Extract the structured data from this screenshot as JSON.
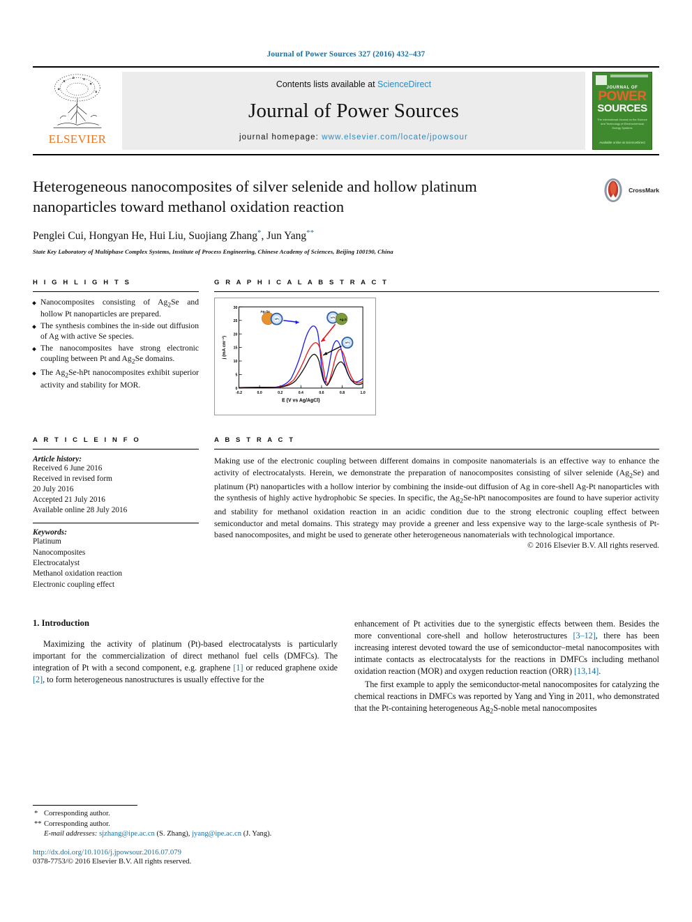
{
  "running_head": "Journal of Power Sources 327 (2016) 432–437",
  "masthead": {
    "contents_prefix": "Contents lists available at ",
    "sciencedirect": "ScienceDirect",
    "journal_name": "Journal of Power Sources",
    "homepage_prefix": "journal homepage: ",
    "homepage_url": "www.elsevier.com/locate/jpowsour",
    "publisher_wordmark": "ELSEVIER",
    "cover": {
      "line_journal_of": "JOURNAL OF",
      "line_power": "POWER",
      "line_sources": "SOURCES",
      "subtitle": "The International Journal on the Science and Technology of Electrochemical Energy Systems",
      "footer": "Available online at\nScienceDirect"
    },
    "accent_blue": "#2b8bc4",
    "elsevier_orange": "#e87722",
    "cover_green": "#3f8a2e"
  },
  "article": {
    "title": "Heterogeneous nanocomposites of silver selenide and hollow platinum nanoparticles toward methanol oxidation reaction",
    "authors_plain": "Penglei Cui, Hongyan He, Hui Liu, Suojiang Zhang",
    "author_last": "Jun Yang",
    "affiliation": "State Key Laboratory of Multiphase Complex Systems, Institute of Process Engineering, Chinese Academy of Sciences, Beijing 100190, China",
    "crossmark_label": "CrossMark"
  },
  "highlights": {
    "heading": "H I G H L I G H T S",
    "items": [
      "Nanocomposites consisting of Ag2Se and hollow Pt nanoparticles are prepared.",
      "The synthesis combines the in-side out diffusion of Ag with active Se species.",
      "The nanocomposites have strong electronic coupling between Pt and Ag2Se domains.",
      "The Ag2Se-hPt nanocomposites exhibit superior activity and stability for MOR."
    ]
  },
  "graphical_abstract": {
    "heading": "G R A P H I C A L   A B S T R A C T"
  },
  "chart_data": {
    "type": "line",
    "title": "",
    "xlabel": "E (V vs Ag/AgCl)",
    "ylabel": "j (mA cm-2)",
    "xlim": [
      -0.2,
      1.0
    ],
    "ylim": [
      0,
      30
    ],
    "xticks": [
      "-0.2",
      "0.0",
      "0.2",
      "0.4",
      "0.6",
      "0.8",
      "1.0"
    ],
    "yticks": [
      "0",
      "5",
      "10",
      "15",
      "20",
      "25",
      "30"
    ],
    "grid": false,
    "legend_position": "inset-annotations",
    "annotations": [
      {
        "label": "Ag2Se-hPt",
        "color": "#2222dd"
      },
      {
        "label": "hPt-Ag2S",
        "color": "#dd2222"
      },
      {
        "label": "hPt",
        "color": "#111111"
      }
    ],
    "series": [
      {
        "name": "Ag2Se-hPt",
        "color": "#1a1aee",
        "forward_peak": {
          "x": 0.53,
          "y": 22.0
        },
        "reverse_peak": {
          "x": 0.66,
          "y": 17.0
        },
        "onset_x": 0.18
      },
      {
        "name": "hPt-Ag2S",
        "color": "#ee1111",
        "forward_peak": {
          "x": 0.57,
          "y": 14.5
        },
        "reverse_peak": {
          "x": 0.68,
          "y": 13.5
        },
        "onset_x": 0.2
      },
      {
        "name": "hPt",
        "color": "#111111",
        "forward_peak": {
          "x": 0.55,
          "y": 11.0
        },
        "reverse_peak": {
          "x": 0.67,
          "y": 9.0
        },
        "onset_x": 0.24
      }
    ]
  },
  "article_info": {
    "heading": "A R T I C L E   I N F O",
    "history_label": "Article history:",
    "history": [
      "Received 6 June 2016",
      "Received in revised form",
      "20 July 2016",
      "Accepted 21 July 2016",
      "Available online 28 July 2016"
    ],
    "keywords_label": "Keywords:",
    "keywords": [
      "Platinum",
      "Nanocomposites",
      "Electrocatalyst",
      "Methanol oxidation reaction",
      "Electronic coupling effect"
    ]
  },
  "abstract": {
    "heading": "A B S T R A C T",
    "body": "Making use of the electronic coupling between different domains in composite nanomaterials is an effective way to enhance the activity of electrocatalysts. Herein, we demonstrate the preparation of nanocomposites consisting of silver selenide (Ag2Se) and platinum (Pt) nanoparticles with a hollow interior by combining the inside-out diffusion of Ag in core-shell Ag-Pt nanoparticles with the synthesis of highly active hydrophobic Se species. In specific, the Ag2Se-hPt nanocomposites are found to have superior activity and stability for methanol oxidation reaction in an acidic condition due to the strong electronic coupling effect between semiconductor and metal domains. This strategy may provide a greener and less expensive way to the large-scale synthesis of Pt-based nanocomposites, and might be used to generate other heterogeneous nanomaterials with technological importance.",
    "copyright": "© 2016 Elsevier B.V. All rights reserved."
  },
  "body": {
    "section_number_title": "1. Introduction",
    "left_paragraph": "Maximizing the activity of platinum (Pt)-based electrocatalysts is particularly important for the commercialization of direct methanol fuel cells (DMFCs). The integration of Pt with a second component, e.g. graphene [1] or reduced graphene oxide [2], to form heterogeneous nanostructures is usually effective for the",
    "right_paragraph_1": "enhancement of Pt activities due to the synergistic effects between them. Besides the more conventional core-shell and hollow heterostructures [3–12], there has been increasing interest devoted toward the use of semiconductor–metal nanocomposites with intimate contacts as electrocatalysts for the reactions in DMFCs including methanol oxidation reaction (MOR) and oxygen reduction reaction (ORR) [13,14].",
    "right_paragraph_2": "The first example to apply the semiconductor-metal nanocomposites for catalyzing the chemical reactions in DMFCs was reported by Yang and Ying in 2011, who demonstrated that the Pt-containing heterogeneous Ag2S-noble metal nanocomposites"
  },
  "footnotes": {
    "corresponding_1": "Corresponding author.",
    "corresponding_2": "Corresponding author.",
    "email_label": "E-mail addresses:",
    "email_1": "sjzhang@ipe.ac.cn",
    "email_1_name": "(S. Zhang),",
    "email_2": "jyang@ipe.ac.cn",
    "email_2_name": "(J. Yang).",
    "doi": "http://dx.doi.org/10.1016/j.jpowsour.2016.07.079",
    "issn": "0378-7753/© 2016 Elsevier B.V. All rights reserved."
  }
}
